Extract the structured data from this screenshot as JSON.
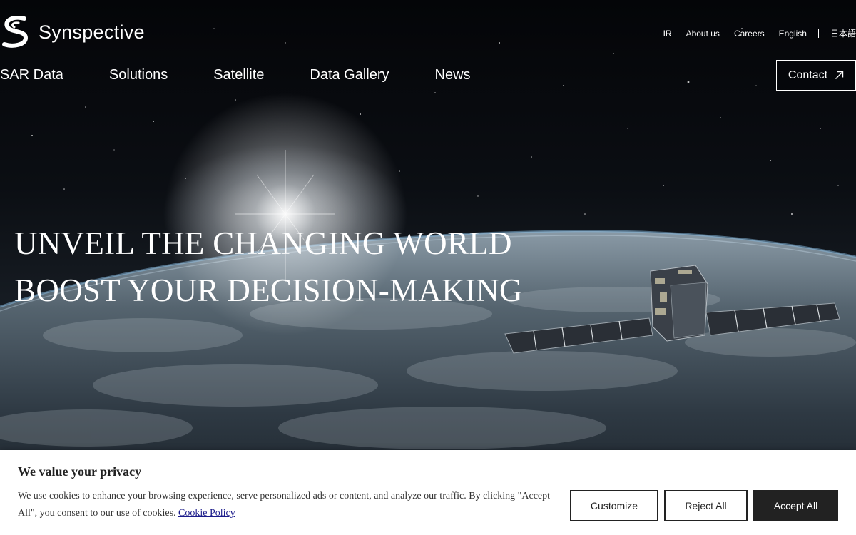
{
  "brand": {
    "name": "Synspective"
  },
  "util_nav": {
    "ir": "IR",
    "about": "About us",
    "careers": "Careers",
    "english": "English",
    "japanese": "日本語"
  },
  "main_nav": {
    "sar_data": "SAR Data",
    "solutions": "Solutions",
    "satellite": "Satellite",
    "data_gallery": "Data Gallery",
    "news": "News"
  },
  "contact": {
    "label": "Contact",
    "icon": "arrow-up-right-icon"
  },
  "hero": {
    "line1": "UNVEIL THE CHANGING WORLD",
    "line2": "BOOST YOUR DECISION-MAKING"
  },
  "cookie_banner": {
    "title": "We value your privacy",
    "text": "We use cookies to enhance your browsing experience, serve personalized ads or content, and analyze our traffic. By clicking \"Accept All\", you consent to our use of cookies.",
    "policy_link": "Cookie Policy",
    "customize": "Customize",
    "reject": "Reject All",
    "accept": "Accept All"
  },
  "colors": {
    "banner_background": "#ffffff",
    "accept_button": "#222222",
    "text_on_hero": "#ffffff"
  }
}
